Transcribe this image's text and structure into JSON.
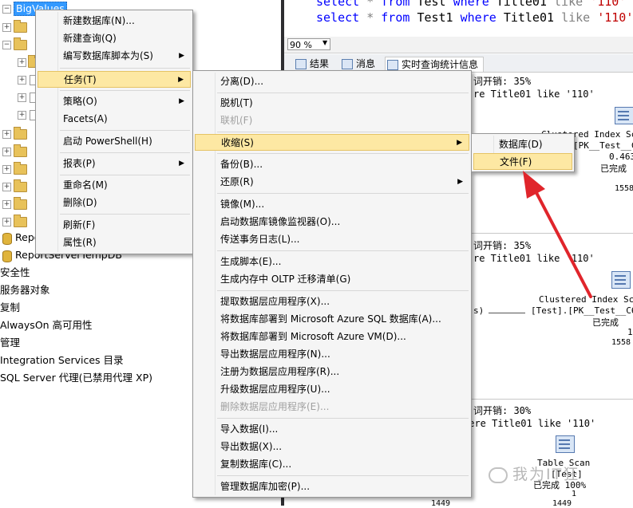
{
  "explorer": {
    "selected_node": "BigValues",
    "nodes": [
      "ReportServer",
      "ReportServerTempDB",
      "安全性",
      "服务器对象",
      "复制",
      "AlwaysOn 高可用性",
      "管理",
      "Integration Services 目录",
      "SQL Server 代理(已禁用代理 XP)"
    ]
  },
  "editor": {
    "line1": [
      "select",
      "*",
      "from",
      "Test",
      "where",
      "Title01",
      "like",
      "'110'"
    ],
    "line2": [
      "select",
      "*",
      "from",
      "Test1",
      "where",
      "Title01",
      "like",
      "'110'"
    ]
  },
  "zoom": "90 %",
  "result_tabs": [
    "结果",
    "消息",
    "实时查询统计信息"
  ],
  "plans": [
    {
      "cost": "词开销: 35%",
      "query": "re Title01 like '110'",
      "op": "Clustered Index Sc",
      "obj": "[PK__Test__C",
      "cost_val": "0.463",
      "status": "已完成",
      "rows": "1558"
    },
    {
      "cost": "词开销: 35%",
      "query": "re Title01 like '110'",
      "op": "Clustered Index Sc",
      "obj": "[Test].[PK__Test__C6",
      "cost_val": "1",
      "status": "已完成",
      "rows": "1558",
      "extra": "s)"
    },
    {
      "cost": "词开销: 30%",
      "query": "here Title01 like '110'",
      "op": "Table Scan",
      "obj": "[Test]",
      "status": "已完成 100%",
      "rows": "1",
      "rows2": "1449"
    }
  ],
  "menu_main": {
    "items": [
      {
        "label": "新建数据库(N)...",
        "submenu": false,
        "disabled": false
      },
      {
        "label": "新建查询(Q)",
        "submenu": false,
        "disabled": false
      },
      {
        "label": "编写数据库脚本为(S)",
        "submenu": true,
        "disabled": false
      },
      {
        "label": "任务(T)",
        "submenu": true,
        "disabled": false,
        "highlighted": true
      },
      {
        "label": "策略(O)",
        "submenu": true,
        "disabled": false
      },
      {
        "label": "Facets(A)",
        "submenu": false,
        "disabled": false
      },
      {
        "label": "启动 PowerShell(H)",
        "submenu": false,
        "disabled": false
      },
      {
        "label": "报表(P)",
        "submenu": true,
        "disabled": false
      },
      {
        "label": "重命名(M)",
        "submenu": false,
        "disabled": false
      },
      {
        "label": "删除(D)",
        "submenu": false,
        "disabled": false
      },
      {
        "label": "刷新(F)",
        "submenu": false,
        "disabled": false
      },
      {
        "label": "属性(R)",
        "submenu": false,
        "disabled": false
      }
    ]
  },
  "menu_tasks": {
    "items": [
      {
        "label": "分离(D)...",
        "submenu": false,
        "disabled": false
      },
      {
        "label": "脱机(T)",
        "submenu": false,
        "disabled": false
      },
      {
        "label": "联机(F)",
        "submenu": false,
        "disabled": true
      },
      {
        "label": "收缩(S)",
        "submenu": true,
        "disabled": false,
        "highlighted": true
      },
      {
        "label": "备份(B)...",
        "submenu": false,
        "disabled": false
      },
      {
        "label": "还原(R)",
        "submenu": true,
        "disabled": false
      },
      {
        "label": "镜像(M)...",
        "submenu": false,
        "disabled": false
      },
      {
        "label": "启动数据库镜像监视器(O)...",
        "submenu": false,
        "disabled": false
      },
      {
        "label": "传送事务日志(L)...",
        "submenu": false,
        "disabled": false
      },
      {
        "label": "生成脚本(E)...",
        "submenu": false,
        "disabled": false
      },
      {
        "label": "生成内存中 OLTP 迁移清单(G)",
        "submenu": false,
        "disabled": false
      },
      {
        "label": "提取数据层应用程序(X)...",
        "submenu": false,
        "disabled": false
      },
      {
        "label": "将数据库部署到 Microsoft Azure SQL 数据库(A)...",
        "submenu": false,
        "disabled": false
      },
      {
        "label": "将数据库部署到 Microsoft Azure VM(D)...",
        "submenu": false,
        "disabled": false
      },
      {
        "label": "导出数据层应用程序(N)...",
        "submenu": false,
        "disabled": false
      },
      {
        "label": "注册为数据层应用程序(R)...",
        "submenu": false,
        "disabled": false
      },
      {
        "label": "升级数据层应用程序(U)...",
        "submenu": false,
        "disabled": false
      },
      {
        "label": "删除数据层应用程序(E)...",
        "submenu": false,
        "disabled": true
      },
      {
        "label": "导入数据(I)...",
        "submenu": false,
        "disabled": false
      },
      {
        "label": "导出数据(X)...",
        "submenu": false,
        "disabled": false
      },
      {
        "label": "复制数据库(C)...",
        "submenu": false,
        "disabled": false
      },
      {
        "label": "管理数据库加密(P)...",
        "submenu": false,
        "disabled": false
      }
    ]
  },
  "menu_shrink": {
    "items": [
      {
        "label": "数据库(D)",
        "highlighted": false
      },
      {
        "label": "文件(F)",
        "highlighted": true
      }
    ]
  },
  "watermark": "我为IT狂",
  "colors": {
    "highlight": "#fde8a3",
    "selection": "#3399ff",
    "arrow": "#e0252b"
  }
}
